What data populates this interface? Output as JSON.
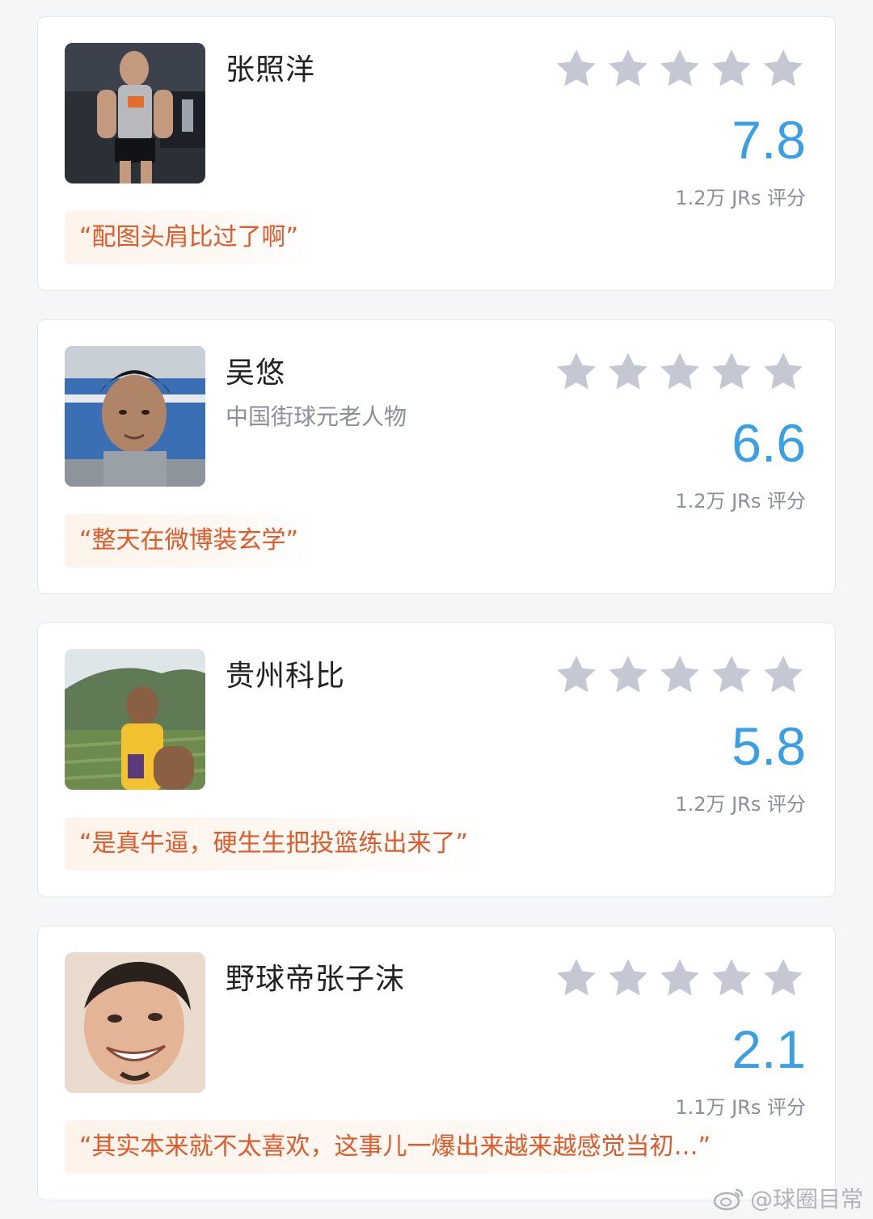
{
  "colors": {
    "score": "#3aa0e6",
    "star": "#c5c7d3",
    "quote_text": "#e15a2a",
    "quote_bg": "#fdf3ea"
  },
  "cards": [
    {
      "name": "张照洋",
      "subtitle": "",
      "stars_filled": 0,
      "score": "7.8",
      "raters": "1.2万 JRs 评分",
      "quote": "“配图头肩比过了啊”"
    },
    {
      "name": "吴悠",
      "subtitle": "中国街球元老人物",
      "stars_filled": 0,
      "score": "6.6",
      "raters": "1.2万 JRs 评分",
      "quote": "“整天在微博装玄学”"
    },
    {
      "name": "贵州科比",
      "subtitle": "",
      "stars_filled": 0,
      "score": "5.8",
      "raters": "1.2万 JRs 评分",
      "quote": "“是真牛逼，硬生生把投篮练出来了”"
    },
    {
      "name": "野球帝张子沫",
      "subtitle": "",
      "stars_filled": 0,
      "score": "2.1",
      "raters": "1.1万 JRs 评分",
      "quote": "“其实本来就不太喜欢，这事儿一爆出来越来越感觉当初…”"
    }
  ],
  "watermark": "@球圈目常"
}
